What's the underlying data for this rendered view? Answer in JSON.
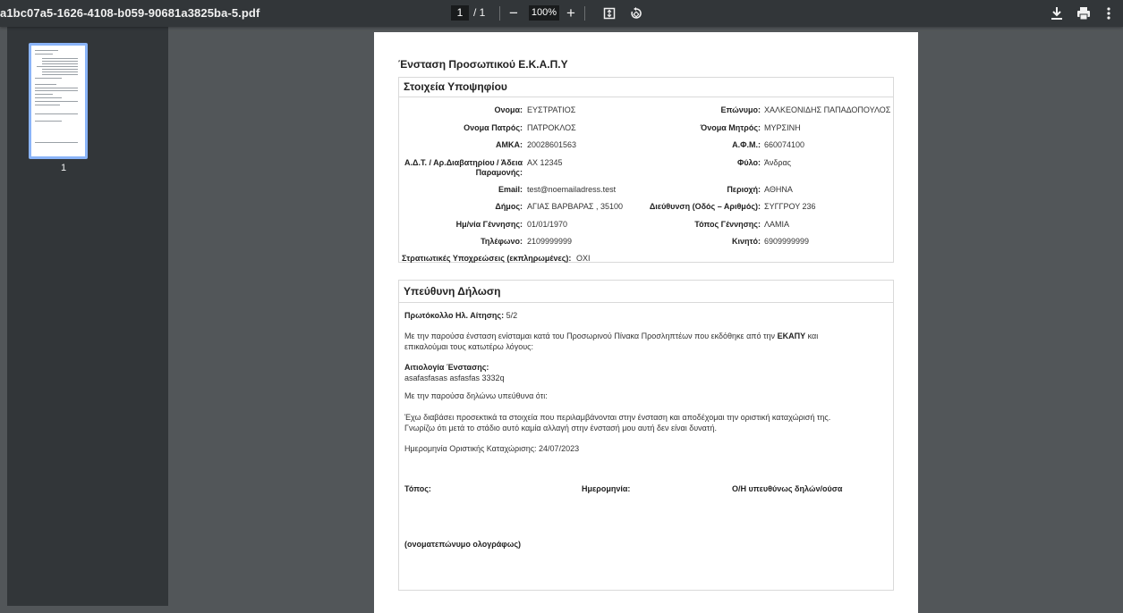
{
  "toolbar": {
    "filename": "a1bc07a5-1626-4108-b059-90681a3825ba-5.pdf",
    "current_page": "1",
    "page_total": "/ 1",
    "zoom": "100%",
    "zoom_out_label": "−",
    "zoom_in_label": "+",
    "icons": [
      "fit-page-icon",
      "rotate-icon",
      "download-icon",
      "print-icon",
      "more-icon"
    ]
  },
  "sidebar": {
    "thumbnail_label": "1"
  },
  "document": {
    "title": "Ένσταση Προσωπικού Ε.Κ.Α.Π.Υ",
    "candidate": {
      "heading": "Στοιχεία Υποψηφίου",
      "fields": {
        "name_label": "Ονομα:",
        "name_value": "ΕΥΣΤΡΑΤΙΟΣ",
        "surname_label": "Επώνυμο:",
        "surname_value": "ΧΑΛΚΕΟΝΙΔΗΣ ΠΑΠΑΔΟΠΟΥΛΟΣ",
        "father_label": "Ονομα Πατρός:",
        "father_value": "ΠΑΤΡΟΚΛΟΣ",
        "mother_label": "Όνομα Μητρός:",
        "mother_value": "ΜΥΡΣΙΝΗ",
        "amka_label": "ΑΜΚΑ:",
        "amka_value": "20028601563",
        "afm_label": "Α.Φ.Μ.:",
        "afm_value": "660074100",
        "id_label": "Α.Δ.Τ. / Αρ.Διαβατηρίου / Άδεια Παραμονής:",
        "id_value": "AX 12345",
        "gender_label": "Φύλο:",
        "gender_value": "Άνδρας",
        "email_label": "Email:",
        "email_value": "test@noemailadress.test",
        "region_label": "Περιοχή:",
        "region_value": "ΑΘΗΝΑ",
        "municipality_label": "Δήμος:",
        "municipality_value": "ΑΓΙΑΣ ΒΑΡΒΑΡΑΣ , 35100",
        "address_label": "Διεύθυνση (Οδός – Αριθμός):",
        "address_value": "ΣΥΓΓΡΟΥ 236",
        "birthdate_label": "Ημ/νία Γέννησης:",
        "birthdate_value": "01/01/1970",
        "birthplace_label": "Τόπος Γέννησης:",
        "birthplace_value": "ΛΑΜΙΑ",
        "phone_label": "Τηλέφωνο:",
        "phone_value": "2109999999",
        "mobile_label": "Κινητό:",
        "mobile_value": "6909999999",
        "military_label": "Στρατιωτικές Υποχρεώσεις (εκπληρωμένες):",
        "military_value": "ΟΧΙ"
      }
    },
    "declaration": {
      "heading": "Υπεύθυνη Δήλωση",
      "protocol_label": "Πρωτόκολλο Ηλ. Αίτησης:",
      "protocol_value": "5/2",
      "intro_part1": "Με την παρούσα ένσταση ενίσταμαι κατά του Προσωρινού Πίνακα Προσληπτέων που εκδόθηκε από την",
      "intro_bold": "ΕΚΑΠΥ",
      "intro_part2": "και",
      "intro_line2": "επικαλούμαι τους κατωτέρω λόγους:",
      "reason_label": "Αιτιολογία Ένστασης:",
      "reason_value": "asafasfasas asfasfas 3332q",
      "declare_line": "Με την παρούσα δηλώνω υπεύθυνα ότι:",
      "statement_line1": "Έχω διαβάσει προσεκτικά τα στοιχεία που περιλαμβάνονται στην ένσταση και αποδέχομαι την οριστική καταχώρισή της.",
      "statement_line2": "Γνωρίζω ότι μετά το στάδιο αυτό καμία αλλαγή στην ένστασή μου αυτή δεν είναι δυνατή.",
      "final_date_line": "Ημερομηνία Οριστικής Καταχώρισης: 24/07/2023",
      "place_label": "Τόπος:",
      "date_label": "Ημερομηνία:",
      "declarant_label": "Ο/Η υπευθύνως δηλών/ούσα",
      "fullname_label": "(ονοματεπώνυμο ολογράφως)"
    }
  }
}
